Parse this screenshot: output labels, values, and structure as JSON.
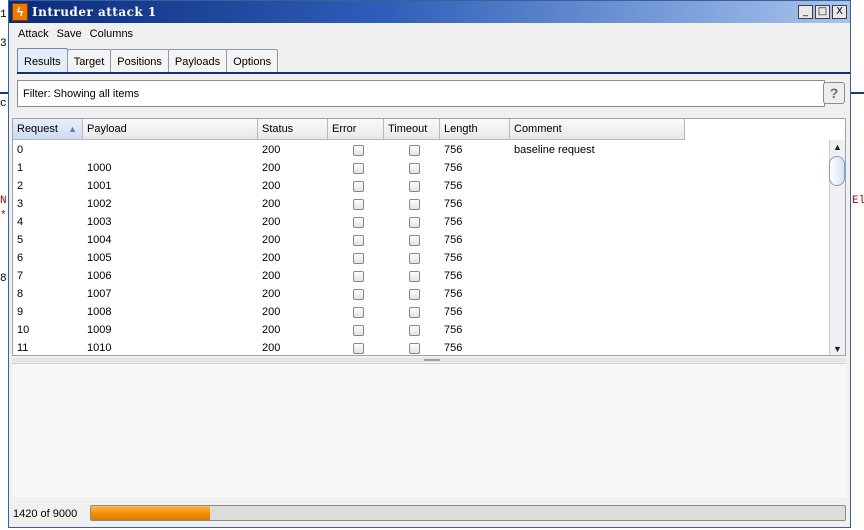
{
  "background_fragments": {
    "left_top": "1",
    "left_2": "c",
    "left_3": "3",
    "left_4": "8",
    "left_red_1": "N",
    "left_red_2": "*",
    "right_red": "El"
  },
  "window": {
    "title": "Intruder attack 1",
    "app_icon": "burp-lightning-icon",
    "controls": {
      "minimize": "_",
      "maximize": "□",
      "close": "X"
    }
  },
  "menu": [
    "Attack",
    "Save",
    "Columns"
  ],
  "tabs": [
    {
      "label": "Results",
      "active": true
    },
    {
      "label": "Target",
      "active": false
    },
    {
      "label": "Positions",
      "active": false
    },
    {
      "label": "Payloads",
      "active": false
    },
    {
      "label": "Options",
      "active": false
    }
  ],
  "filter": {
    "text": "Filter:  Showing all items",
    "help": "?"
  },
  "table": {
    "columns": [
      {
        "label": "Request",
        "sorted": true
      },
      {
        "label": "Payload"
      },
      {
        "label": "Status"
      },
      {
        "label": "Error"
      },
      {
        "label": "Timeout"
      },
      {
        "label": "Length"
      },
      {
        "label": "Comment"
      }
    ],
    "rows": [
      {
        "request": "0",
        "payload": "",
        "status": "200",
        "error": false,
        "timeout": false,
        "length": "756",
        "comment": "baseline request"
      },
      {
        "request": "1",
        "payload": "1000",
        "status": "200",
        "error": false,
        "timeout": false,
        "length": "756",
        "comment": ""
      },
      {
        "request": "2",
        "payload": "1001",
        "status": "200",
        "error": false,
        "timeout": false,
        "length": "756",
        "comment": ""
      },
      {
        "request": "3",
        "payload": "1002",
        "status": "200",
        "error": false,
        "timeout": false,
        "length": "756",
        "comment": ""
      },
      {
        "request": "4",
        "payload": "1003",
        "status": "200",
        "error": false,
        "timeout": false,
        "length": "756",
        "comment": ""
      },
      {
        "request": "5",
        "payload": "1004",
        "status": "200",
        "error": false,
        "timeout": false,
        "length": "756",
        "comment": ""
      },
      {
        "request": "6",
        "payload": "1005",
        "status": "200",
        "error": false,
        "timeout": false,
        "length": "756",
        "comment": ""
      },
      {
        "request": "7",
        "payload": "1006",
        "status": "200",
        "error": false,
        "timeout": false,
        "length": "756",
        "comment": ""
      },
      {
        "request": "8",
        "payload": "1007",
        "status": "200",
        "error": false,
        "timeout": false,
        "length": "756",
        "comment": ""
      },
      {
        "request": "9",
        "payload": "1008",
        "status": "200",
        "error": false,
        "timeout": false,
        "length": "756",
        "comment": ""
      },
      {
        "request": "10",
        "payload": "1009",
        "status": "200",
        "error": false,
        "timeout": false,
        "length": "756",
        "comment": ""
      },
      {
        "request": "11",
        "payload": "1010",
        "status": "200",
        "error": false,
        "timeout": false,
        "length": "756",
        "comment": ""
      }
    ]
  },
  "status": {
    "text": "1420 of 9000",
    "progress_fraction": 0.1578
  },
  "colors": {
    "accent": "#f08a00",
    "title_bar": "#0a2a7a"
  }
}
